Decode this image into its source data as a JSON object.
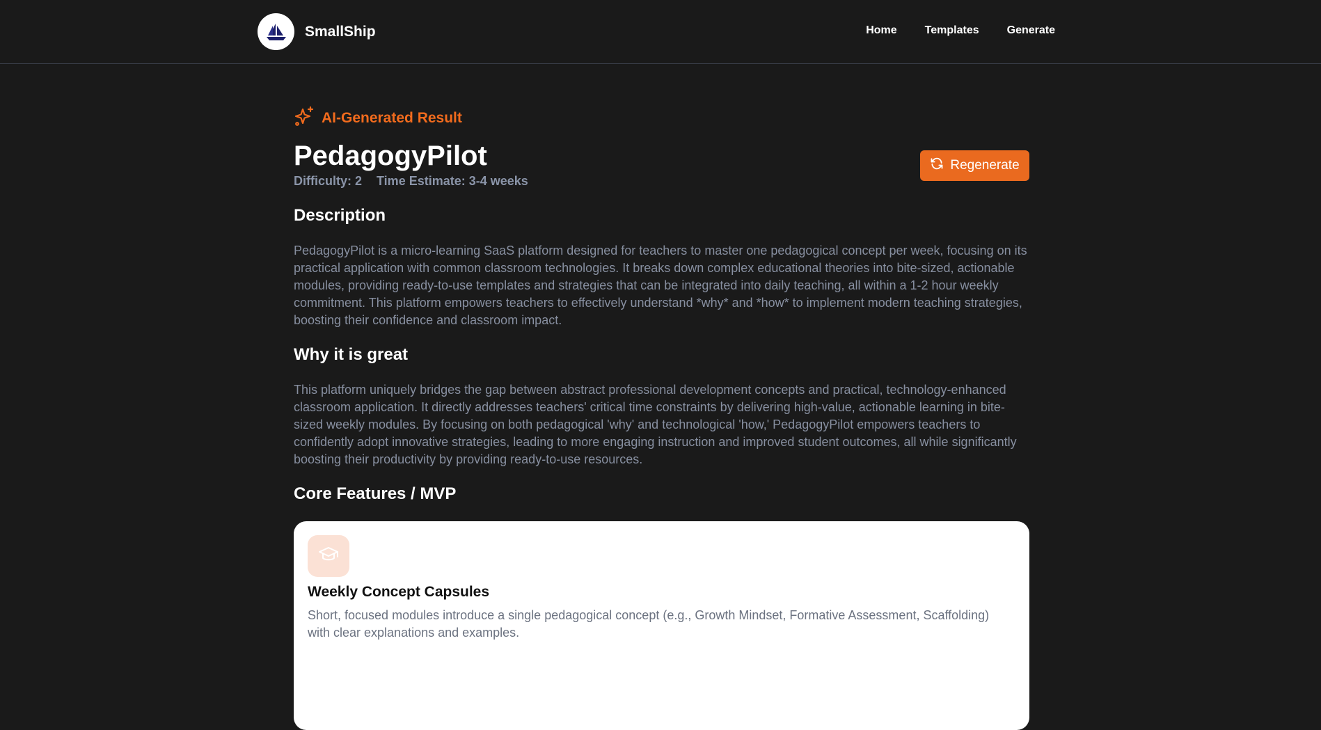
{
  "brand": {
    "name": "SmallShip",
    "logo_icon": "ship-icon"
  },
  "nav": {
    "items": [
      "Home",
      "Templates",
      "Generate"
    ]
  },
  "result": {
    "ai_label": "AI-Generated Result",
    "ai_icon": "sparkles-icon",
    "title": "PedagogyPilot",
    "difficulty": "Difficulty: 2",
    "time_estimate": "Time Estimate: 3-4 weeks",
    "regenerate_label": "Regenerate",
    "regenerate_icon": "refresh-icon"
  },
  "sections": {
    "description": {
      "heading": "Description",
      "text": "PedagogyPilot is a micro-learning SaaS platform designed for teachers to master one pedagogical concept per week, focusing on its practical application with common classroom technologies. It breaks down complex educational theories into bite-sized, actionable modules, providing ready-to-use templates and strategies that can be integrated into daily teaching, all within a 1-2 hour weekly commitment. This platform empowers teachers to effectively understand *why* and *how* to implement modern teaching strategies, boosting their confidence and classroom impact."
    },
    "why_great": {
      "heading": "Why it is great",
      "text": "This platform uniquely bridges the gap between abstract professional development concepts and practical, technology-enhanced classroom application. It directly addresses teachers' critical time constraints by delivering high-value, actionable learning in bite-sized weekly modules. By focusing on both pedagogical 'why' and technological 'how,' PedagogyPilot empowers teachers to confidently adopt innovative strategies, leading to more engaging instruction and improved student outcomes, all while significantly boosting their productivity by providing ready-to-use resources."
    },
    "core_features": {
      "heading": "Core Features / MVP",
      "items": [
        {
          "icon": "graduation-cap-icon",
          "title": "Weekly Concept Capsules",
          "description": "Short, focused modules introduce a single pedagogical concept (e.g., Growth Mindset, Formative Assessment, Scaffolding) with clear explanations and examples."
        }
      ]
    }
  },
  "colors": {
    "background": "#1a1a1a",
    "accent": "#ea6a1f",
    "muted_text": "#878fa0",
    "card_background": "#ffffff",
    "icon_tile": "#fbe1d5"
  }
}
